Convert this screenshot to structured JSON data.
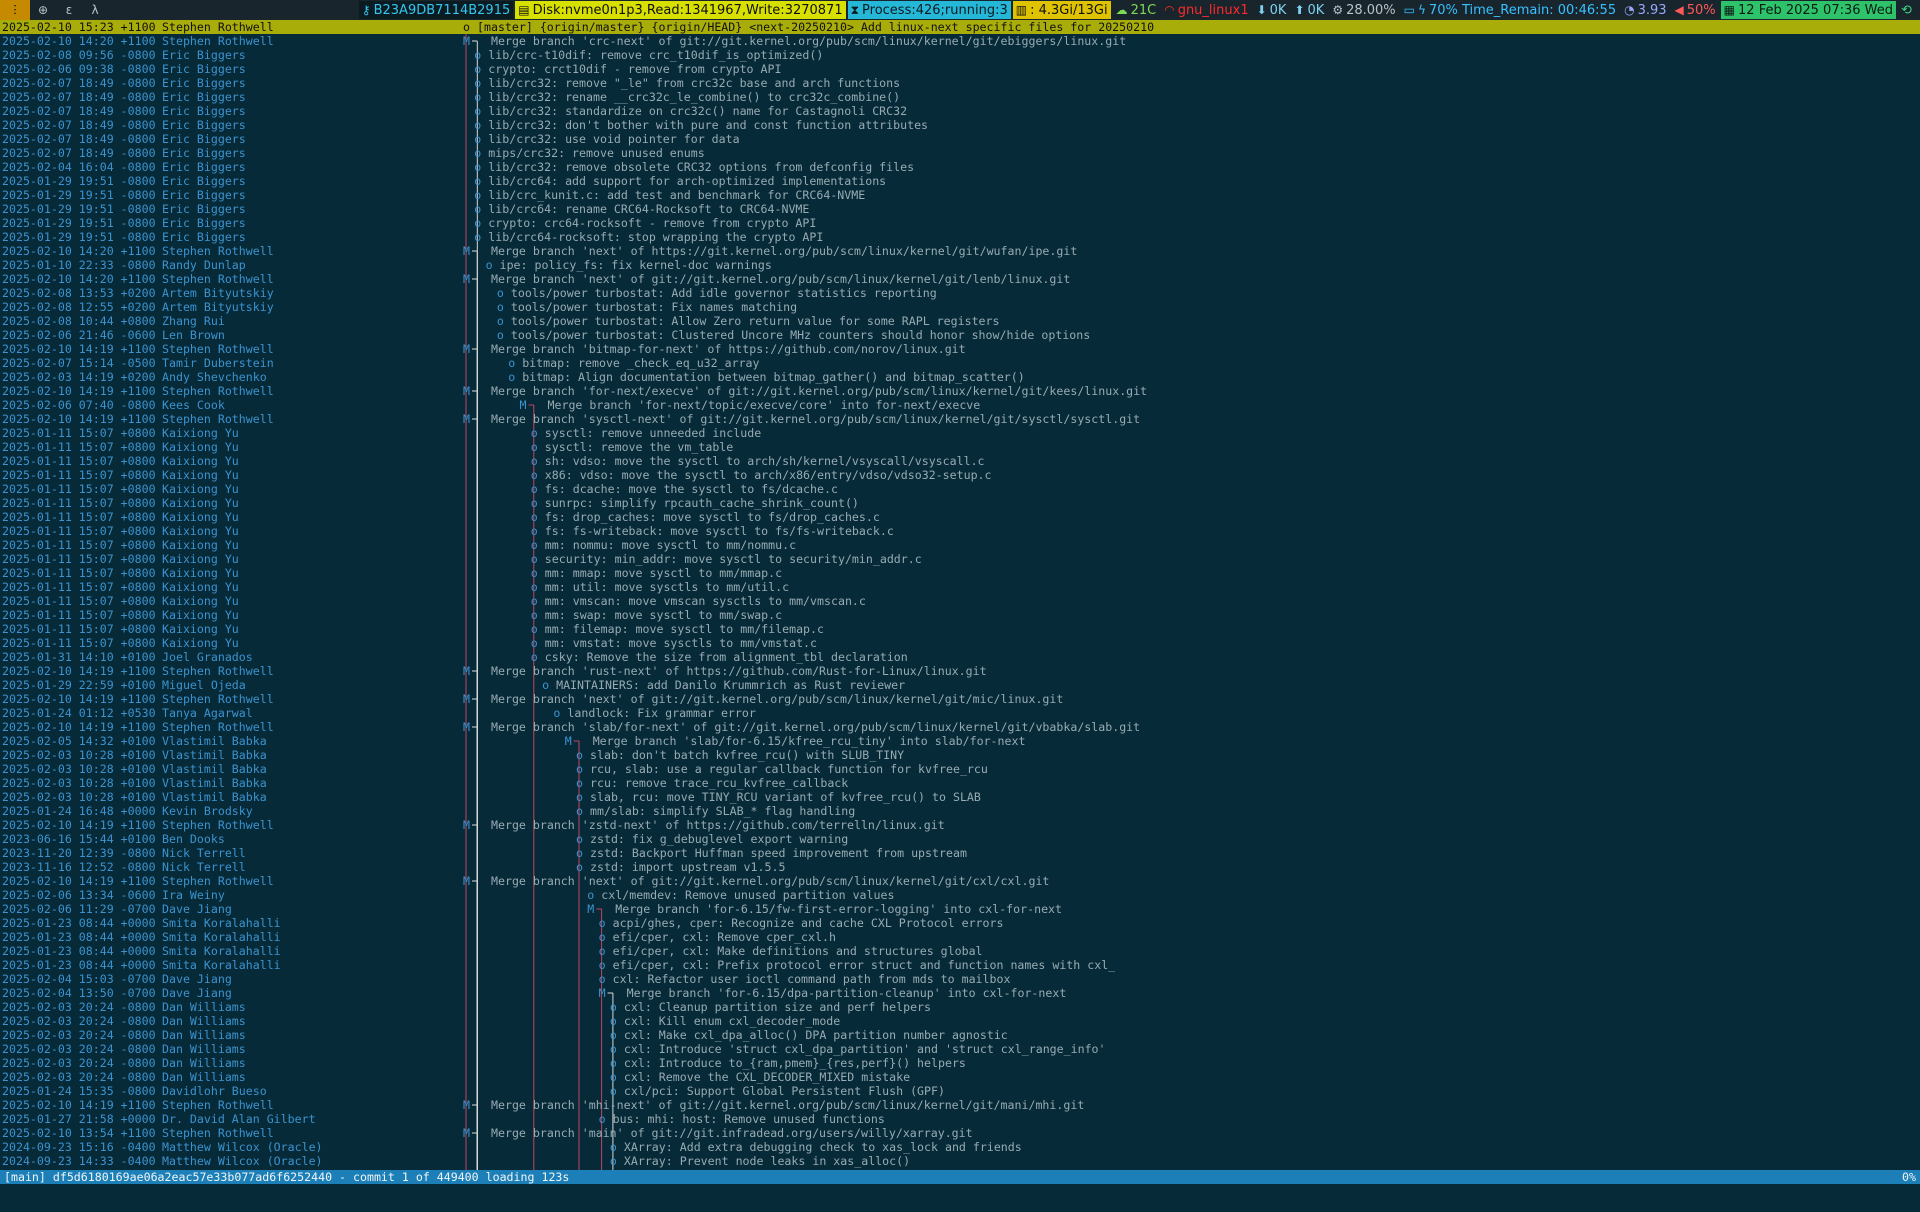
{
  "topbar": {
    "workspaces": [
      "ⵗ",
      "⊕",
      "ɛ",
      "λ"
    ],
    "host": "B23A9DB7114B2915",
    "disk": "Disk:nvme0n1p3,Read:1341967,Write:3270871",
    "process": "Process:426;running:3",
    "memory": ": 4.3Gi/13Gi",
    "temperature": "21C",
    "wifi": "gnu_linux1",
    "net_down": "0K",
    "net_up": "0K",
    "cpu": "28.00%",
    "battery": "70% Time_Remain: 00:46:55",
    "load": "3.93",
    "volume": "50%",
    "datetime": "12 Feb 2025 07:36 Wed"
  },
  "commits": [
    {
      "date": "2025-02-10 15:23 +1100",
      "author": "Stephen Rothwell",
      "graph": "o",
      "subject": "[master] {origin/master} {origin/HEAD} <next-20250210> Add linux-next specific files for 20250210",
      "selected": true
    },
    {
      "date": "2025-02-10 14:20 +1100",
      "author": "Stephen Rothwell",
      "graph": "M",
      "subject": "Merge branch 'crc-next' of git://git.kernel.org/pub/scm/linux/kernel/git/ebiggers/linux.git"
    },
    {
      "date": "2025-02-08 09:56 -0800",
      "author": "Eric Biggers",
      "graph": "o",
      "subject": "lib/crc-t10dif: remove crc_t10dif_is_optimized()"
    },
    {
      "date": "2025-02-06 09:38 -0800",
      "author": "Eric Biggers",
      "graph": "o",
      "subject": "crypto: crct10dif - remove from crypto API"
    },
    {
      "date": "2025-02-07 18:49 -0800",
      "author": "Eric Biggers",
      "graph": "o",
      "subject": "lib/crc32: remove \"_le\" from crc32c base and arch functions"
    },
    {
      "date": "2025-02-07 18:49 -0800",
      "author": "Eric Biggers",
      "graph": "o",
      "subject": "lib/crc32: rename __crc32c_le_combine() to crc32c_combine()"
    },
    {
      "date": "2025-02-07 18:49 -0800",
      "author": "Eric Biggers",
      "graph": "o",
      "subject": "lib/crc32: standardize on crc32c() name for Castagnoli CRC32"
    },
    {
      "date": "2025-02-07 18:49 -0800",
      "author": "Eric Biggers",
      "graph": "o",
      "subject": "lib/crc32: don't bother with pure and const function attributes"
    },
    {
      "date": "2025-02-07 18:49 -0800",
      "author": "Eric Biggers",
      "graph": "o",
      "subject": "lib/crc32: use void pointer for data"
    },
    {
      "date": "2025-02-07 18:49 -0800",
      "author": "Eric Biggers",
      "graph": "o",
      "subject": "mips/crc32: remove unused enums"
    },
    {
      "date": "2025-02-04 16:04 -0800",
      "author": "Eric Biggers",
      "graph": "o",
      "subject": "lib/crc32: remove obsolete CRC32 options from defconfig files"
    },
    {
      "date": "2025-01-29 19:51 -0800",
      "author": "Eric Biggers",
      "graph": "o",
      "subject": "lib/crc64: add support for arch-optimized implementations"
    },
    {
      "date": "2025-01-29 19:51 -0800",
      "author": "Eric Biggers",
      "graph": "o",
      "subject": "lib/crc_kunit.c: add test and benchmark for CRC64-NVME"
    },
    {
      "date": "2025-01-29 19:51 -0800",
      "author": "Eric Biggers",
      "graph": "o",
      "subject": "lib/crc64: rename CRC64-Rocksoft to CRC64-NVME"
    },
    {
      "date": "2025-01-29 19:51 -0800",
      "author": "Eric Biggers",
      "graph": "o",
      "subject": "crypto: crc64-rocksoft - remove from crypto API"
    },
    {
      "date": "2025-01-29 19:51 -0800",
      "author": "Eric Biggers",
      "graph": "o",
      "subject": "lib/crc64-rocksoft: stop wrapping the crypto API"
    },
    {
      "date": "2025-02-10 14:20 +1100",
      "author": "Stephen Rothwell",
      "graph": "M",
      "subject": "Merge branch 'next' of https://git.kernel.org/pub/scm/linux/kernel/git/wufan/ipe.git"
    },
    {
      "date": "2025-01-10 22:33 -0800",
      "author": "Randy Dunlap",
      "graph": "o",
      "subject": "ipe: policy_fs: fix kernel-doc warnings"
    },
    {
      "date": "2025-02-10 14:20 +1100",
      "author": "Stephen Rothwell",
      "graph": "M",
      "subject": "Merge branch 'next' of git://git.kernel.org/pub/scm/linux/kernel/git/lenb/linux.git"
    },
    {
      "date": "2025-02-08 13:53 +0200",
      "author": "Artem Bityutskiy",
      "graph": "o",
      "subject": "tools/power turbostat: Add idle governor statistics reporting"
    },
    {
      "date": "2025-02-08 12:55 +0200",
      "author": "Artem Bityutskiy",
      "graph": "o",
      "subject": "tools/power turbostat: Fix names matching"
    },
    {
      "date": "2025-02-08 10:44 +0800",
      "author": "Zhang Rui",
      "graph": "o",
      "subject": "tools/power turbostat: Allow Zero return value for some RAPL registers"
    },
    {
      "date": "2025-02-06 21:46 -0600",
      "author": "Len Brown",
      "graph": "o",
      "subject": "tools/power turbostat: Clustered Uncore MHz counters should honor show/hide options"
    },
    {
      "date": "2025-02-10 14:19 +1100",
      "author": "Stephen Rothwell",
      "graph": "M",
      "subject": "Merge branch 'bitmap-for-next' of https://github.com/norov/linux.git"
    },
    {
      "date": "2025-02-07 15:14 -0500",
      "author": "Tamir Duberstein",
      "graph": "o",
      "subject": "bitmap: remove _check_eq_u32_array"
    },
    {
      "date": "2025-02-03 14:19 +0200",
      "author": "Andy Shevchenko",
      "graph": "o",
      "subject": "bitmap: Align documentation between bitmap_gather() and bitmap_scatter()"
    },
    {
      "date": "2025-02-10 14:19 +1100",
      "author": "Stephen Rothwell",
      "graph": "M",
      "subject": "Merge branch 'for-next/execve' of git://git.kernel.org/pub/scm/linux/kernel/git/kees/linux.git"
    },
    {
      "date": "2025-02-06 07:40 -0800",
      "author": "Kees Cook",
      "graph": "M",
      "subject": "Merge branch 'for-next/topic/execve/core' into for-next/execve"
    },
    {
      "date": "2025-02-10 14:19 +1100",
      "author": "Stephen Rothwell",
      "graph": "M",
      "subject": "Merge branch 'sysctl-next' of git://git.kernel.org/pub/scm/linux/kernel/git/sysctl/sysctl.git"
    },
    {
      "date": "2025-01-11 15:07 +0800",
      "author": "Kaixiong Yu",
      "graph": "o",
      "subject": "sysctl: remove unneeded include"
    },
    {
      "date": "2025-01-11 15:07 +0800",
      "author": "Kaixiong Yu",
      "graph": "o",
      "subject": "sysctl: remove the vm_table"
    },
    {
      "date": "2025-01-11 15:07 +0800",
      "author": "Kaixiong Yu",
      "graph": "o",
      "subject": "sh: vdso: move the sysctl to arch/sh/kernel/vsyscall/vsyscall.c"
    },
    {
      "date": "2025-01-11 15:07 +0800",
      "author": "Kaixiong Yu",
      "graph": "o",
      "subject": "x86: vdso: move the sysctl to arch/x86/entry/vdso/vdso32-setup.c"
    },
    {
      "date": "2025-01-11 15:07 +0800",
      "author": "Kaixiong Yu",
      "graph": "o",
      "subject": "fs: dcache: move the sysctl to fs/dcache.c"
    },
    {
      "date": "2025-01-11 15:07 +0800",
      "author": "Kaixiong Yu",
      "graph": "o",
      "subject": "sunrpc: simplify rpcauth_cache_shrink_count()"
    },
    {
      "date": "2025-01-11 15:07 +0800",
      "author": "Kaixiong Yu",
      "graph": "o",
      "subject": "fs: drop_caches: move sysctl to fs/drop_caches.c"
    },
    {
      "date": "2025-01-11 15:07 +0800",
      "author": "Kaixiong Yu",
      "graph": "o",
      "subject": "fs: fs-writeback: move sysctl to fs/fs-writeback.c"
    },
    {
      "date": "2025-01-11 15:07 +0800",
      "author": "Kaixiong Yu",
      "graph": "o",
      "subject": "mm: nommu: move sysctl to mm/nommu.c"
    },
    {
      "date": "2025-01-11 15:07 +0800",
      "author": "Kaixiong Yu",
      "graph": "o",
      "subject": "security: min_addr: move sysctl to security/min_addr.c"
    },
    {
      "date": "2025-01-11 15:07 +0800",
      "author": "Kaixiong Yu",
      "graph": "o",
      "subject": "mm: mmap: move sysctl to mm/mmap.c"
    },
    {
      "date": "2025-01-11 15:07 +0800",
      "author": "Kaixiong Yu",
      "graph": "o",
      "subject": "mm: util: move sysctls to mm/util.c"
    },
    {
      "date": "2025-01-11 15:07 +0800",
      "author": "Kaixiong Yu",
      "graph": "o",
      "subject": "mm: vmscan: move vmscan sysctls to mm/vmscan.c"
    },
    {
      "date": "2025-01-11 15:07 +0800",
      "author": "Kaixiong Yu",
      "graph": "o",
      "subject": "mm: swap: move sysctl to mm/swap.c"
    },
    {
      "date": "2025-01-11 15:07 +0800",
      "author": "Kaixiong Yu",
      "graph": "o",
      "subject": "mm: filemap: move sysctl to mm/filemap.c"
    },
    {
      "date": "2025-01-11 15:07 +0800",
      "author": "Kaixiong Yu",
      "graph": "o",
      "subject": "mm: vmstat: move sysctls to mm/vmstat.c"
    },
    {
      "date": "2025-01-31 14:10 +0100",
      "author": "Joel Granados",
      "graph": "o",
      "subject": "csky: Remove the size from alignment_tbl declaration"
    },
    {
      "date": "2025-02-10 14:19 +1100",
      "author": "Stephen Rothwell",
      "graph": "M",
      "subject": "Merge branch 'rust-next' of https://github.com/Rust-for-Linux/linux.git"
    },
    {
      "date": "2025-01-29 22:59 +0100",
      "author": "Miguel Ojeda",
      "graph": "o",
      "subject": "MAINTAINERS: add Danilo Krummrich as Rust reviewer"
    },
    {
      "date": "2025-02-10 14:19 +1100",
      "author": "Stephen Rothwell",
      "graph": "M",
      "subject": "Merge branch 'next' of git://git.kernel.org/pub/scm/linux/kernel/git/mic/linux.git"
    },
    {
      "date": "2025-01-24 01:12 +0530",
      "author": "Tanya Agarwal",
      "graph": "o",
      "subject": "landlock: Fix grammar error"
    },
    {
      "date": "2025-02-10 14:19 +1100",
      "author": "Stephen Rothwell",
      "graph": "M",
      "subject": "Merge branch 'slab/for-next' of git://git.kernel.org/pub/scm/linux/kernel/git/vbabka/slab.git"
    },
    {
      "date": "2025-02-05 14:32 +0100",
      "author": "Vlastimil Babka",
      "graph": "M",
      "subject": "Merge branch 'slab/for-6.15/kfree_rcu_tiny' into slab/for-next"
    },
    {
      "date": "2025-02-03 10:28 +0100",
      "author": "Vlastimil Babka",
      "graph": "o",
      "subject": "slab: don't batch kvfree_rcu() with SLUB_TINY"
    },
    {
      "date": "2025-02-03 10:28 +0100",
      "author": "Vlastimil Babka",
      "graph": "o",
      "subject": "rcu, slab: use a regular callback function for kvfree_rcu"
    },
    {
      "date": "2025-02-03 10:28 +0100",
      "author": "Vlastimil Babka",
      "graph": "o",
      "subject": "rcu: remove trace_rcu_kvfree_callback"
    },
    {
      "date": "2025-02-03 10:28 +0100",
      "author": "Vlastimil Babka",
      "graph": "o",
      "subject": "slab, rcu: move TINY_RCU variant of kvfree_rcu() to SLAB"
    },
    {
      "date": "2025-01-24 16:48 +0000",
      "author": "Kevin Brodsky",
      "graph": "o",
      "subject": "mm/slab: simplify SLAB_* flag handling"
    },
    {
      "date": "2025-02-10 14:19 +1100",
      "author": "Stephen Rothwell",
      "graph": "M",
      "subject": "Merge branch 'zstd-next' of https://github.com/terrelln/linux.git"
    },
    {
      "date": "2023-06-16 15:44 +0100",
      "author": "Ben Dooks",
      "graph": "o",
      "subject": "zstd: fix g_debuglevel export warning"
    },
    {
      "date": "2023-11-20 12:39 -0800",
      "author": "Nick Terrell",
      "graph": "o",
      "subject": "zstd: Backport Huffman speed improvement from upstream"
    },
    {
      "date": "2023-11-16 12:52 -0800",
      "author": "Nick Terrell",
      "graph": "o",
      "subject": "zstd: import upstream v1.5.5"
    },
    {
      "date": "2025-02-10 14:19 +1100",
      "author": "Stephen Rothwell",
      "graph": "M",
      "subject": "Merge branch 'next' of git://git.kernel.org/pub/scm/linux/kernel/git/cxl/cxl.git"
    },
    {
      "date": "2025-02-06 13:34 -0600",
      "author": "Ira Weiny",
      "graph": "o",
      "subject": "cxl/memdev: Remove unused partition values"
    },
    {
      "date": "2025-02-06 11:29 -0700",
      "author": "Dave Jiang",
      "graph": "M",
      "subject": "Merge branch 'for-6.15/fw-first-error-logging' into cxl-for-next"
    },
    {
      "date": "2025-01-23 08:44 +0000",
      "author": "Smita Koralahalli",
      "graph": "o",
      "subject": "acpi/ghes, cper: Recognize and cache CXL Protocol errors"
    },
    {
      "date": "2025-01-23 08:44 +0000",
      "author": "Smita Koralahalli",
      "graph": "o",
      "subject": "efi/cper, cxl: Remove cper_cxl.h"
    },
    {
      "date": "2025-01-23 08:44 +0000",
      "author": "Smita Koralahalli",
      "graph": "o",
      "subject": "efi/cper, cxl: Make definitions and structures global"
    },
    {
      "date": "2025-01-23 08:44 +0000",
      "author": "Smita Koralahalli",
      "graph": "o",
      "subject": "efi/cper, cxl: Prefix protocol error struct and function names with cxl_"
    },
    {
      "date": "2025-02-04 15:03 -0700",
      "author": "Dave Jiang",
      "graph": "o",
      "subject": "cxl: Refactor user ioctl command path from mds to mailbox"
    },
    {
      "date": "2025-02-04 13:50 -0700",
      "author": "Dave Jiang",
      "graph": "M",
      "subject": "Merge branch 'for-6.15/dpa-partition-cleanup' into cxl-for-next"
    },
    {
      "date": "2025-02-03 20:24 -0800",
      "author": "Dan Williams",
      "graph": "o",
      "subject": "cxl: Cleanup partition size and perf helpers"
    },
    {
      "date": "2025-02-03 20:24 -0800",
      "author": "Dan Williams",
      "graph": "o",
      "subject": "cxl: Kill enum cxl_decoder_mode"
    },
    {
      "date": "2025-02-03 20:24 -0800",
      "author": "Dan Williams",
      "graph": "o",
      "subject": "cxl: Make cxl_dpa_alloc() DPA partition number agnostic"
    },
    {
      "date": "2025-02-03 20:24 -0800",
      "author": "Dan Williams",
      "graph": "o",
      "subject": "cxl: Introduce 'struct cxl_dpa_partition' and 'struct cxl_range_info'"
    },
    {
      "date": "2025-02-03 20:24 -0800",
      "author": "Dan Williams",
      "graph": "o",
      "subject": "cxl: Introduce to_{ram,pmem}_{res,perf}() helpers"
    },
    {
      "date": "2025-02-03 20:24 -0800",
      "author": "Dan Williams",
      "graph": "o",
      "subject": "cxl: Remove the CXL_DECODER_MIXED mistake"
    },
    {
      "date": "2025-01-24 15:35 -0800",
      "author": "Davidlohr Bueso",
      "graph": "o",
      "subject": "cxl/pci: Support Global Persistent Flush (GPF)"
    },
    {
      "date": "2025-02-10 14:19 +1100",
      "author": "Stephen Rothwell",
      "graph": "M",
      "subject": "Merge branch 'mhi-next' of git://git.kernel.org/pub/scm/linux/kernel/git/mani/mhi.git"
    },
    {
      "date": "2025-01-27 21:58 +0000",
      "author": "Dr. David Alan Gilbert",
      "graph": "o",
      "subject": "bus: mhi: host: Remove unused functions"
    },
    {
      "date": "2025-02-10 13:54 +1100",
      "author": "Stephen Rothwell",
      "graph": "M",
      "subject": "Merge branch 'main' of git://git.infradead.org/users/willy/xarray.git"
    },
    {
      "date": "2024-09-23 15:16 -0400",
      "author": "Matthew Wilcox (Oracle)",
      "graph": "o",
      "subject": "XArray: Add extra debugging check to xas_lock and friends"
    },
    {
      "date": "2024-09-23 14:33 -0400",
      "author": "Matthew Wilcox (Oracle)",
      "graph": "o",
      "subject": "XArray: Prevent node leaks in xas_alloc()"
    }
  ],
  "statusbar": {
    "message": "[main] df5d6180169ae06a2eac57e33b077ad6f6252440 - commit 1 of 449400 loading 123s",
    "percent": "0%"
  }
}
